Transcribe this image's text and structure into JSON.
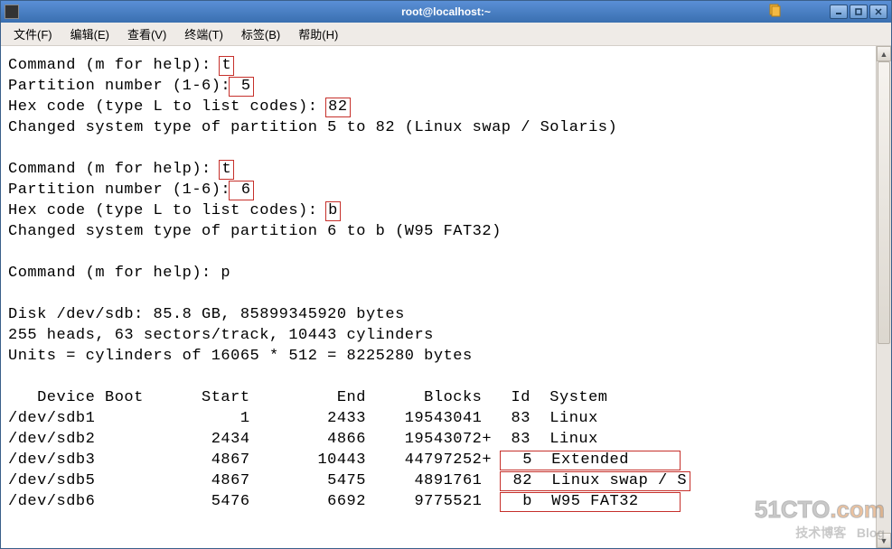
{
  "window": {
    "title": "root@localhost:~"
  },
  "menu": {
    "file": "文件(F)",
    "edit": "编辑(E)",
    "view": "查看(V)",
    "terminal": "终端(T)",
    "tabs": "标签(B)",
    "help": "帮助(H)"
  },
  "term": {
    "l1a": "Command (m for help): ",
    "l1b": "t",
    "l2a": "Partition number (1-6):",
    "l2b": " 5",
    "l3a": "Hex code (type L to list codes): ",
    "l3b": "82",
    "l4": "Changed system type of partition 5 to 82 (Linux swap / Solaris)",
    "l5": "",
    "l6a": "Command (m for help): ",
    "l6b": "t",
    "l7a": "Partition number (1-6):",
    "l7b": " 6",
    "l8a": "Hex code (type L to list codes): ",
    "l8b": "b",
    "l9": "Changed system type of partition 6 to b (W95 FAT32)",
    "l10": "",
    "l11": "Command (m for help): p",
    "l12": "",
    "l13": "Disk /dev/sdb: 85.8 GB, 85899345920 bytes",
    "l14": "255 heads, 63 sectors/track, 10443 cylinders",
    "l15": "Units = cylinders of 16065 * 512 = 8225280 bytes",
    "l16": "",
    "header": "   Device Boot      Start         End      Blocks   Id  System",
    "r1": "/dev/sdb1               1        2433    19543041   83  Linux",
    "r2": "/dev/sdb2            2434        4866    19543072+  83  Linux",
    "r3a": "/dev/sdb3            4867       10443    44797252+ ",
    "r3b": "  5  Extended     ",
    "r4a": "/dev/sdb5            4867        5475     4891761  ",
    "r4b": " 82  Linux swap / S",
    "r5a": "/dev/sdb6            5476        6692     9775521  ",
    "r5b": "  b  W95 FAT32    "
  },
  "watermark": {
    "line1": "51CTO",
    "line2": ".com",
    "sub1": "技术博客",
    "sub2": "Blog"
  }
}
